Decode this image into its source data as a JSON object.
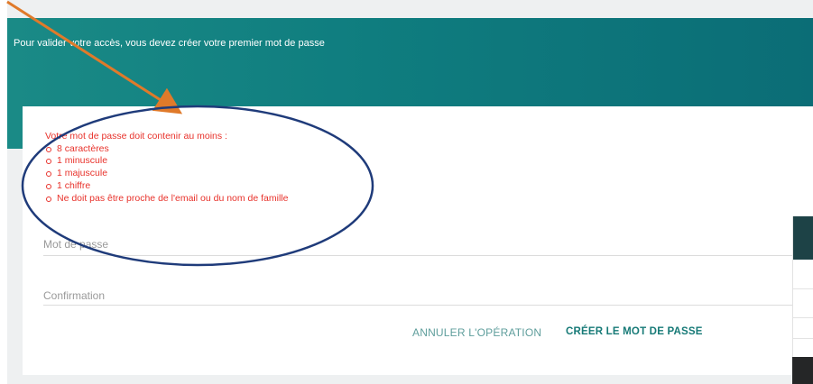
{
  "header": {
    "message": "Pour valider votre accès, vous devez créer votre premier mot de passe"
  },
  "password_rules": {
    "title": "Votre mot de passe doit contenir au moins :",
    "items": [
      "8 caractères",
      "1 minuscule",
      "1 majuscule",
      "1 chiffre",
      "Ne doit pas être proche de l'email ou du nom de famille"
    ]
  },
  "form": {
    "password_placeholder": "Mot de passe",
    "confirmation_placeholder": "Confirmation"
  },
  "actions": {
    "cancel_label": "ANNULER L'OPÉRATION",
    "create_label": "CRÉER LE MOT DE PASSE"
  },
  "colors": {
    "header_teal": "#0f7d7f",
    "rule_red": "#e8322b",
    "annotation_orange": "#e07a2a",
    "annotation_navy": "#1f3b7a"
  }
}
